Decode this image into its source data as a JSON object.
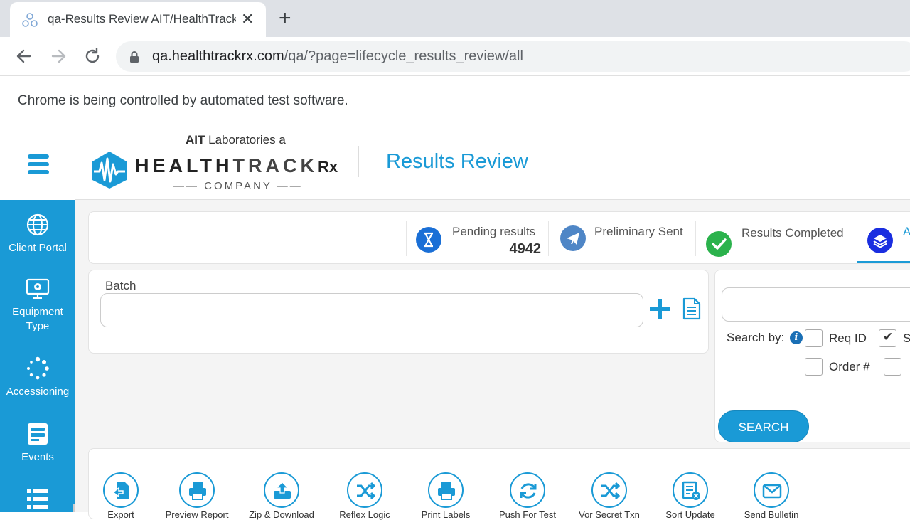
{
  "browser": {
    "tab_title": "qa-Results Review AIT/HealthTrackRx",
    "url_host": "qa.healthtrackrx.com",
    "url_path": "/qa/?page=lifecycle_results_review/all",
    "infobar": "Chrome is being controlled by automated test software."
  },
  "header": {
    "logo_top_bold": "AIT",
    "logo_top_rest": " Laboratories a",
    "logo_main_a": "HEALTH",
    "logo_main_b": "TRACK",
    "logo_rx": "Rx",
    "logo_company": "COMPANY",
    "page_title": "Results Review"
  },
  "sidebar": {
    "items": [
      {
        "label": "Client Portal",
        "icon": "globe-icon"
      },
      {
        "label": "Equipment Type",
        "icon": "monitor-gear-icon"
      },
      {
        "label": "Accessioning",
        "icon": "spinner-icon"
      },
      {
        "label": "Events",
        "icon": "server-list-icon"
      },
      {
        "label": "",
        "icon": "list-icon"
      }
    ]
  },
  "status": {
    "pending_label": "Pending results",
    "pending_count": "4942",
    "preliminary_label": "Preliminary Sent",
    "completed_label": "Results Completed",
    "all_label": "A"
  },
  "batch": {
    "label": "Batch",
    "value": ""
  },
  "search": {
    "value": "",
    "searchby_label": "Search by:",
    "options": [
      {
        "label": "Req ID",
        "checked": false
      },
      {
        "label": "S",
        "checked": true
      },
      {
        "label": "Order #",
        "checked": false
      },
      {
        "label": "",
        "checked": false
      }
    ],
    "button": "SEARCH"
  },
  "actions": [
    {
      "label": "Export",
      "icon": "export-icon"
    },
    {
      "label": "Preview Report",
      "icon": "printer-icon"
    },
    {
      "label": "Zip & Download",
      "icon": "upload-icon"
    },
    {
      "label": "Reflex Logic",
      "icon": "shuffle-icon"
    },
    {
      "label": "Print Labels",
      "icon": "printer-icon"
    },
    {
      "label": "Push For Test",
      "icon": "refresh-icon"
    },
    {
      "label": "Vor Secret Txn",
      "icon": "shuffle-icon"
    },
    {
      "label": "Sort Update",
      "icon": "document-cancel-icon"
    },
    {
      "label": "Send Bulletin",
      "icon": "envelope-icon"
    }
  ],
  "colors": {
    "brand_blue": "#1a9ad6",
    "navy": "#1a2ee0",
    "green": "#2bb24c"
  }
}
